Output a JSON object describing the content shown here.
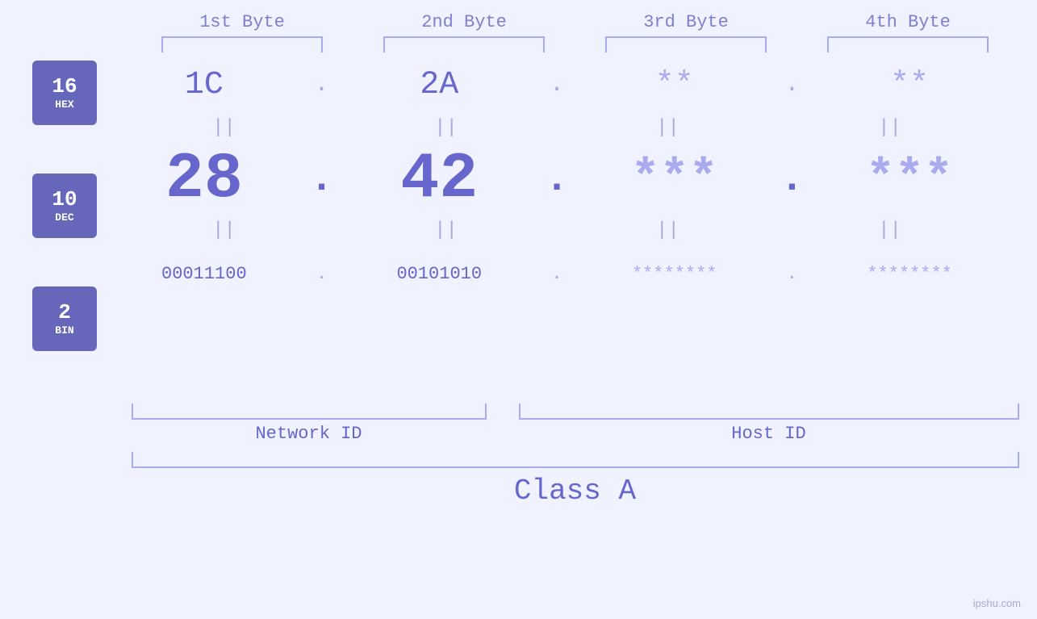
{
  "header": {
    "bytes": [
      {
        "label": "1st Byte"
      },
      {
        "label": "2nd Byte"
      },
      {
        "label": "3rd Byte"
      },
      {
        "label": "4th Byte"
      }
    ]
  },
  "badges": [
    {
      "number": "16",
      "label": "HEX"
    },
    {
      "number": "10",
      "label": "DEC"
    },
    {
      "number": "2",
      "label": "BIN"
    }
  ],
  "values": {
    "hex": [
      "1C",
      "2A",
      "**",
      "**"
    ],
    "dec": [
      "28",
      "42",
      "***",
      "***"
    ],
    "bin": [
      "00011100",
      "00101010",
      "********",
      "********"
    ],
    "dots": [
      ".",
      ".",
      ".",
      ""
    ]
  },
  "network_id_label": "Network ID",
  "host_id_label": "Host ID",
  "class_label": "Class A",
  "watermark": "ipshu.com"
}
